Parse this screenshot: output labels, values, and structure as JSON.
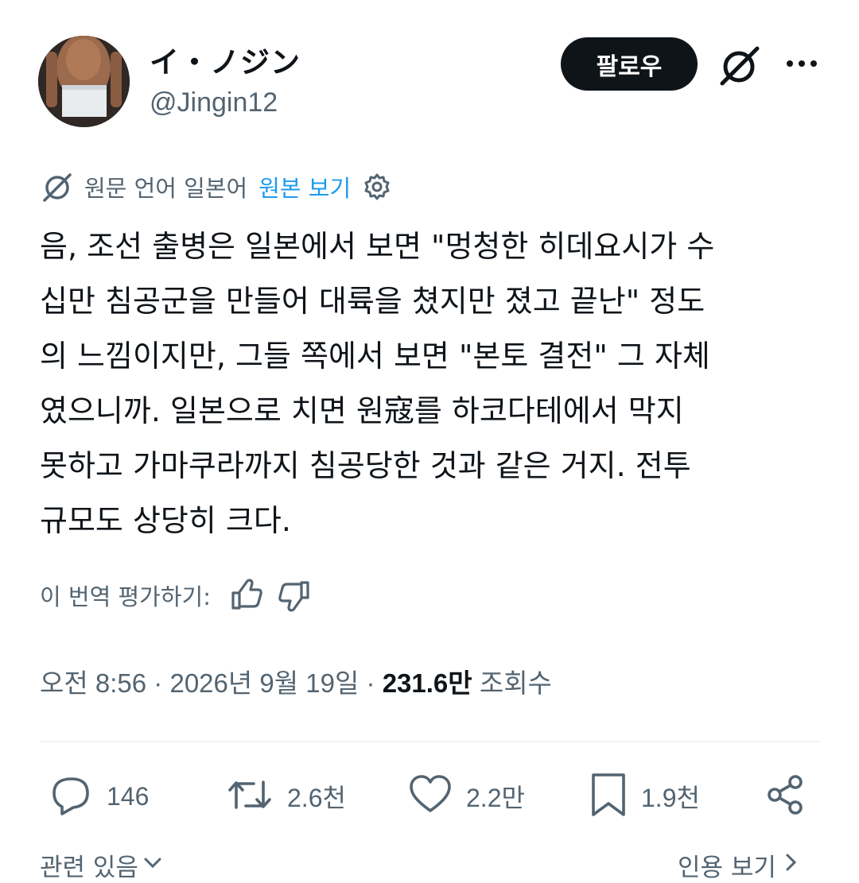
{
  "author": {
    "name": "イ・ノジン",
    "handle": "@Jingin12"
  },
  "header": {
    "follow_label": "팔로우",
    "icons": [
      "grok-icon",
      "more-icon"
    ]
  },
  "translation": {
    "language_note": "원문 언어 일본어",
    "show_original_label": "원본 보기",
    "icons": [
      "grok-icon",
      "gear-icon"
    ]
  },
  "tweet": {
    "lines": [
      "음, 조선 출병은 일본에서 보면 \"멍청한 히데요시가 수",
      "십만 침공군을 만들어 대륙을 쳤지만 졌고 끝난\" 정도",
      "의 느낌이지만, 그들 쪽에서 보면 \"본토 결전\" 그 자체",
      "였으니까. 일본으로 치면 원寇를 하코다테에서 막지",
      "못하고 가마쿠라까지 침공당한 것과 같은 거지. 전투",
      "규모도 상당히 크다."
    ]
  },
  "rating": {
    "label": "이 번역 평가하기:",
    "icons": [
      "thumbs-up-icon",
      "thumbs-down-icon"
    ]
  },
  "meta": {
    "time": "오전 8:56",
    "date": "2026년 9월 19일",
    "views_count": "231.6만",
    "views_label": "조회수",
    "separator": "·"
  },
  "actions": {
    "replies": "146",
    "reposts": "2.6천",
    "likes": "2.2만",
    "bookmarks": "1.9천"
  },
  "footer": {
    "related_label": "관련 있음",
    "quotes_label": "인용 보기"
  },
  "colors": {
    "text": "#0f1419",
    "secondary": "#536471",
    "accent": "#1d9bf0",
    "divider": "#eff3f4"
  }
}
